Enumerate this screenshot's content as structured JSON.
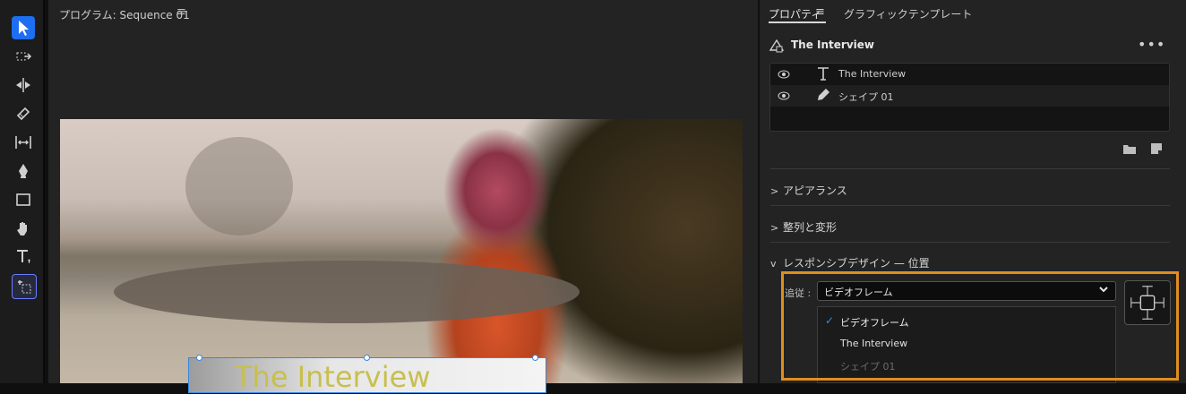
{
  "toolbar": {
    "tools": [
      "selection-tool",
      "track-select-tool",
      "ripple-edit-tool",
      "razor-tool",
      "slip-tool",
      "pen-tool",
      "rectangle-tool",
      "hand-tool",
      "type-tool",
      "responsive-pin-tool"
    ],
    "active": "selection-tool"
  },
  "monitor": {
    "title": "プログラム: Sequence 01",
    "menu_icon": "≡",
    "overlay_title_text": "The Interview"
  },
  "properties": {
    "tabs": [
      {
        "label": "プロパティ",
        "active": true
      },
      {
        "label": "グラフィックテンプレート",
        "active": false
      }
    ],
    "menu_icon": "≡",
    "object_title": "The Interview",
    "more_icon": "•••",
    "layers": [
      {
        "name": "The Interview",
        "type": "text",
        "visible": true
      },
      {
        "name": "シェイプ 01",
        "type": "shape",
        "visible": true
      }
    ],
    "sections": [
      {
        "label": "アピアランス",
        "expanded": false
      },
      {
        "label": "整列と変形",
        "expanded": false
      },
      {
        "label": "レスポンシブデザイン — 位置",
        "expanded": true
      }
    ],
    "responsive": {
      "follow_label": "追従 :",
      "follow_value": "ビデオフレーム",
      "options": [
        {
          "label": "ビデオフレーム",
          "checked": true,
          "enabled": true
        },
        {
          "label": "The Interview",
          "checked": false,
          "enabled": true
        },
        {
          "label": "シェイプ 01",
          "checked": false,
          "enabled": false
        }
      ],
      "check_mark": "✓"
    }
  },
  "colors": {
    "highlight": "#e08e1f",
    "accent": "#1d6ef0"
  }
}
